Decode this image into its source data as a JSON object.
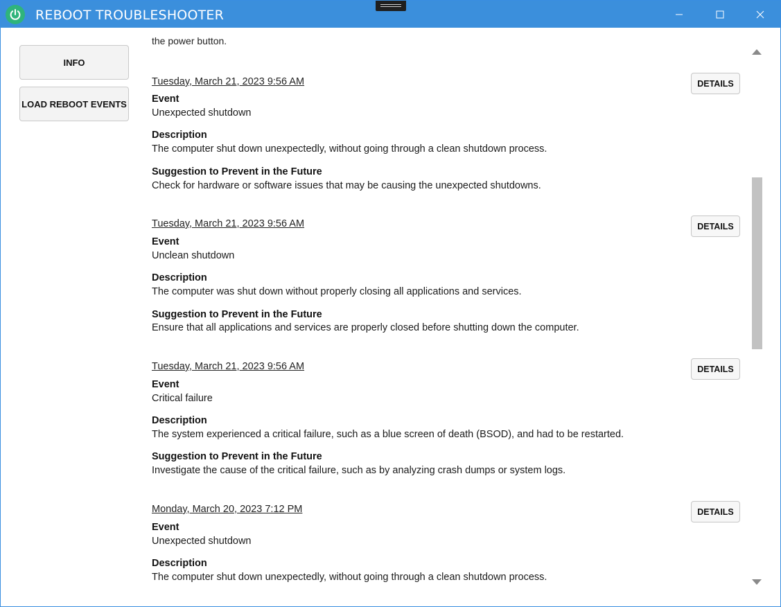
{
  "window": {
    "title": "REBOOT TROUBLESHOOTER"
  },
  "sidebar": {
    "info_label": "INFO",
    "load_label": "LOAD REBOOT EVENTS"
  },
  "partial_text": "the power button.",
  "labels": {
    "event": "Event",
    "description": "Description",
    "suggestion": "Suggestion to Prevent in the Future",
    "details": "DETAILS"
  },
  "events": [
    {
      "date": "Tuesday, March 21, 2023 9:56 AM",
      "event": "Unexpected shutdown",
      "description": "The computer shut down unexpectedly, without going through a clean shutdown process.",
      "suggestion": "Check for hardware or software issues that may be causing the unexpected shutdowns."
    },
    {
      "date": "Tuesday, March 21, 2023 9:56 AM",
      "event": "Unclean shutdown",
      "description": "The computer was shut down without properly closing all applications and services.",
      "suggestion": "Ensure that all applications and services are properly closed before shutting down the computer."
    },
    {
      "date": "Tuesday, March 21, 2023 9:56 AM",
      "event": "Critical failure",
      "description": "The system experienced a critical failure, such as a blue screen of death (BSOD), and had to be restarted.",
      "suggestion": "Investigate the cause of the critical failure, such as by analyzing crash dumps or system logs."
    },
    {
      "date": "Monday, March 20, 2023 7:12 PM",
      "event": "Unexpected shutdown",
      "description": "The computer shut down unexpectedly, without going through a clean shutdown process."
    }
  ]
}
